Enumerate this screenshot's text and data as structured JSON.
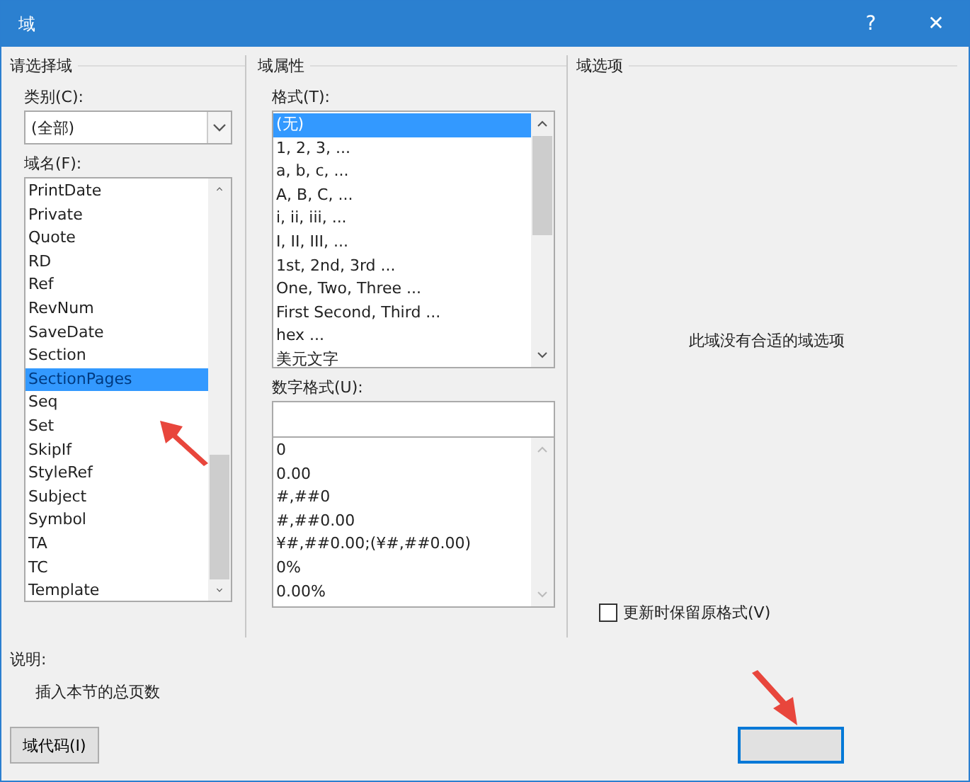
{
  "window": {
    "title": "域",
    "help": "?",
    "close": "✕"
  },
  "select_field": {
    "heading": "请选择域",
    "category_label": "类别(C):",
    "category_value": "(全部)",
    "names_label": "域名(F):",
    "names": [
      {
        "label": "PrintDate",
        "selected": false
      },
      {
        "label": "Private",
        "selected": false
      },
      {
        "label": "Quote",
        "selected": false
      },
      {
        "label": "RD",
        "selected": false
      },
      {
        "label": "Ref",
        "selected": false
      },
      {
        "label": "RevNum",
        "selected": false
      },
      {
        "label": "SaveDate",
        "selected": false
      },
      {
        "label": "Section",
        "selected": false
      },
      {
        "label": "SectionPages",
        "selected": true
      },
      {
        "label": "Seq",
        "selected": false
      },
      {
        "label": "Set",
        "selected": false
      },
      {
        "label": "SkipIf",
        "selected": false
      },
      {
        "label": "StyleRef",
        "selected": false
      },
      {
        "label": "Subject",
        "selected": false
      },
      {
        "label": "Symbol",
        "selected": false
      },
      {
        "label": "TA",
        "selected": false
      },
      {
        "label": "TC",
        "selected": false
      },
      {
        "label": "Template",
        "selected": false
      }
    ]
  },
  "field_properties": {
    "heading": "域属性",
    "format_label": "格式(T):",
    "formats": [
      {
        "label": "(无)",
        "selected": true
      },
      {
        "label": "1, 2, 3, ...",
        "selected": false
      },
      {
        "label": "a, b, c, ...",
        "selected": false
      },
      {
        "label": "A, B, C, ...",
        "selected": false
      },
      {
        "label": "i, ii, iii, ...",
        "selected": false
      },
      {
        "label": "I, II, III, ...",
        "selected": false
      },
      {
        "label": "1st, 2nd, 3rd ...",
        "selected": false
      },
      {
        "label": "One, Two, Three ...",
        "selected": false
      },
      {
        "label": "First Second, Third ...",
        "selected": false
      },
      {
        "label": "hex ...",
        "selected": false
      },
      {
        "label": "美元文字",
        "selected": false
      }
    ],
    "number_format_label": "数字格式(U):",
    "number_formats": [
      "0",
      "0.00",
      "#,##0",
      "#,##0.00",
      "¥#,##0.00;(¥#,##0.00)",
      "0%",
      "0.00%"
    ]
  },
  "field_options": {
    "heading": "域选项",
    "message": "此域没有合适的域选项",
    "preserve_label": "更新时保留原格式(V)",
    "preserve_checked": false
  },
  "description": {
    "label": "说明:",
    "text": "插入本节的总页数"
  },
  "buttons": {
    "field_codes": "域代码(I)"
  }
}
